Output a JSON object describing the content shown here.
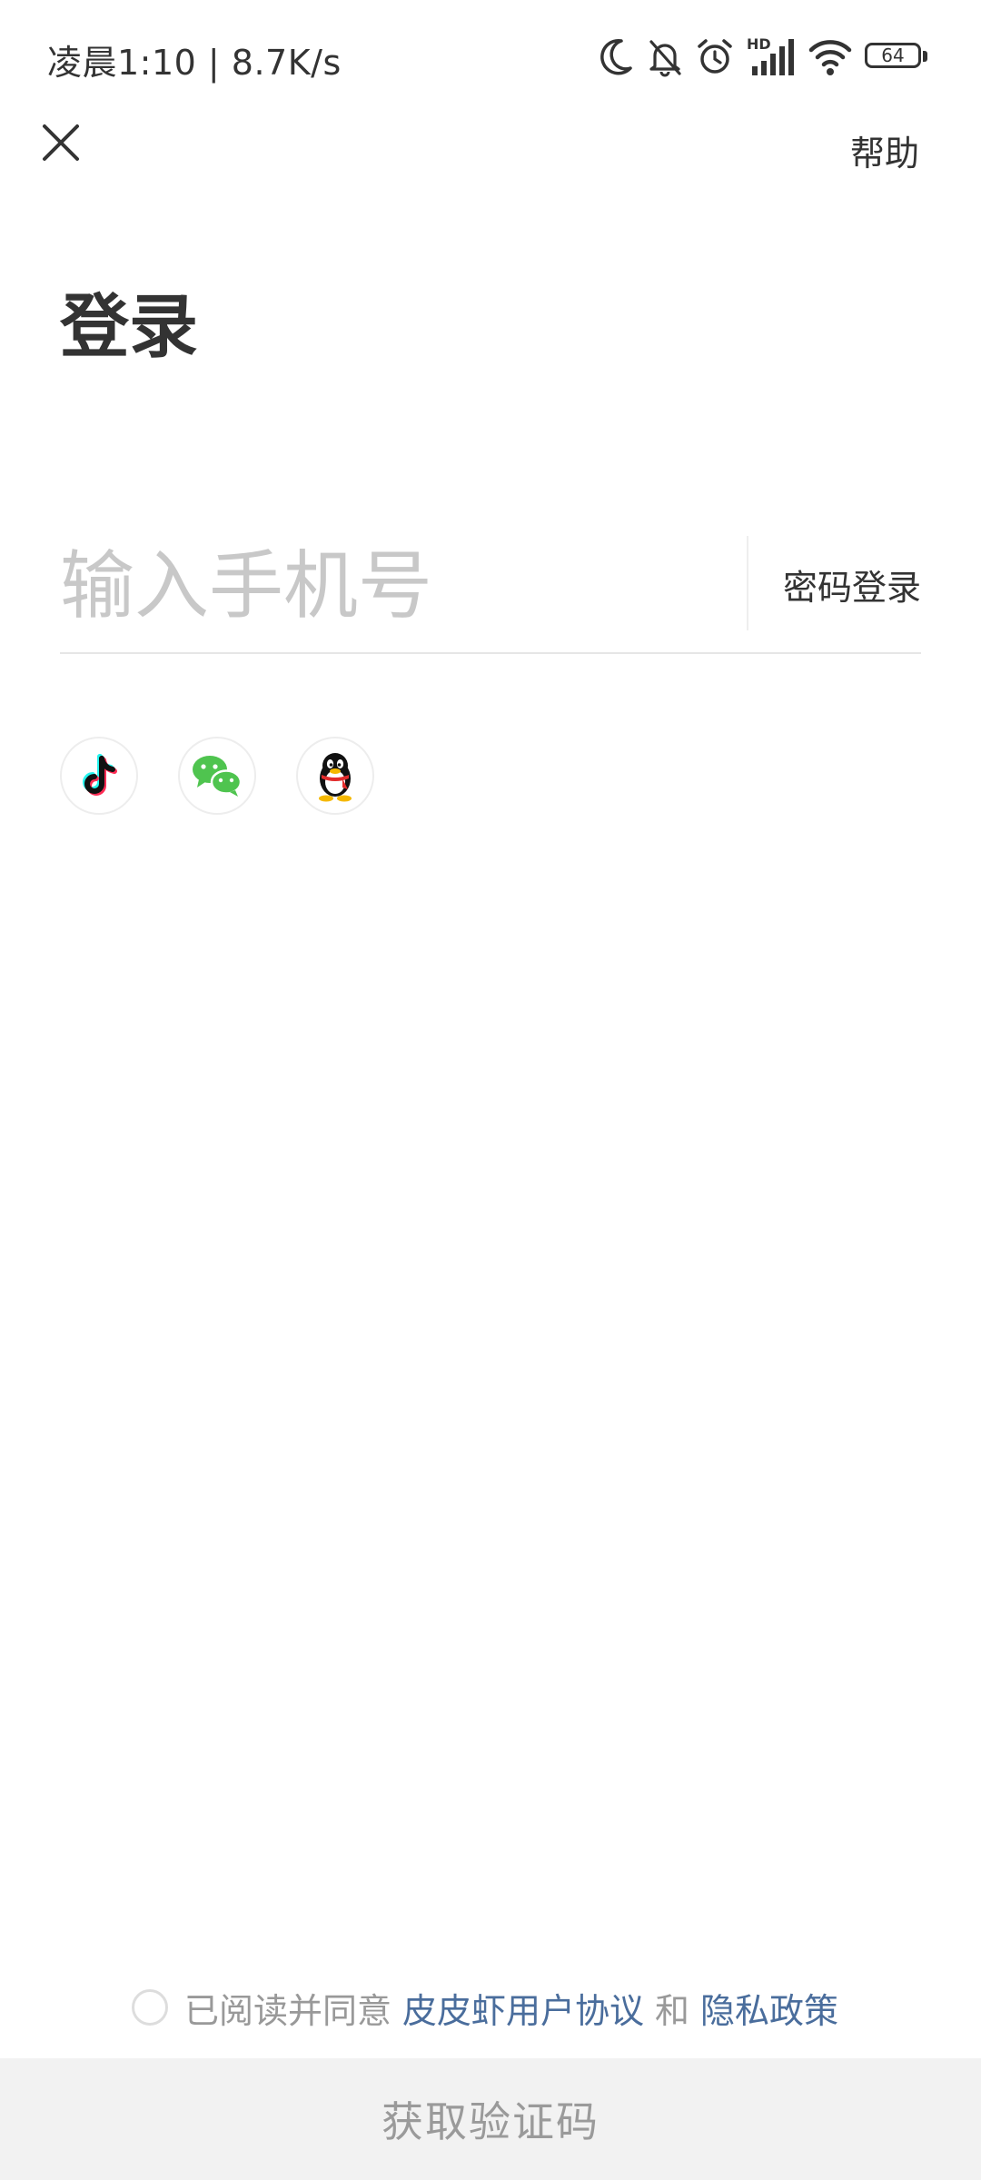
{
  "status_bar": {
    "time_speed": "凌晨1:10 | 8.7K/s",
    "network_label": "HD",
    "battery_level": "64"
  },
  "nav": {
    "help_label": "帮助"
  },
  "page": {
    "title": "登录"
  },
  "phone": {
    "placeholder": "输入手机号",
    "value": "",
    "password_login_label": "密码登录"
  },
  "social": {
    "icons": [
      "tiktok-icon",
      "wechat-icon",
      "qq-icon"
    ]
  },
  "agreement": {
    "prefix": "已阅读并同意",
    "user_agreement_label": "皮皮虾用户协议",
    "and_text": "和",
    "privacy_label": "隐私政策",
    "checked": false
  },
  "submit": {
    "label": "获取验证码"
  },
  "colors": {
    "link": "#4a6d9c",
    "placeholder": "#c8c8c8",
    "button_bg": "#f2f2f2",
    "button_text": "#9a9a9a",
    "wechat_green": "#4fc44f"
  }
}
